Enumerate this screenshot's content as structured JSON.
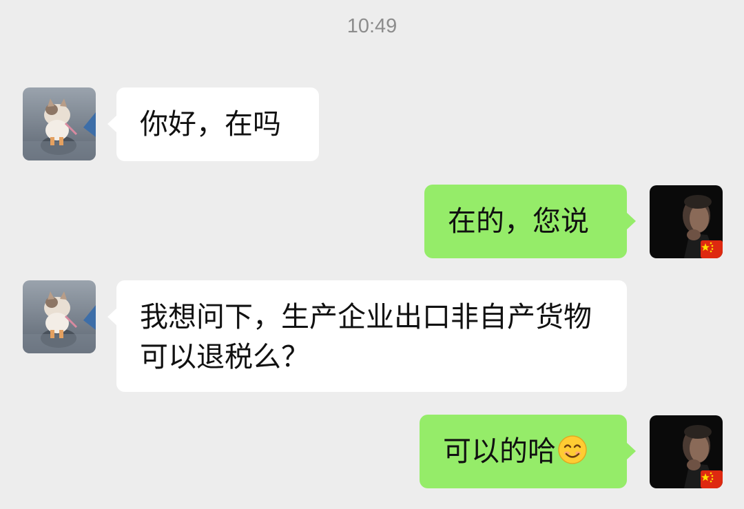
{
  "chat": {
    "timestamp": "10:49",
    "messages": [
      {
        "sender": "contact",
        "text": "你好，在吗"
      },
      {
        "sender": "me",
        "text": "在的，您说"
      },
      {
        "sender": "contact",
        "text": "我想问下，生产企业出口非自产货物可以退税么？"
      },
      {
        "sender": "me",
        "text": "可以的哈",
        "emoji": "smiling-face-emoji"
      }
    ]
  },
  "colors": {
    "background": "#ededed",
    "incoming_bubble": "#ffffff",
    "outgoing_bubble": "#95ec69",
    "timestamp_text": "#8c8c8c"
  },
  "icons": {
    "contact_avatar": "cat-photo-avatar",
    "my_avatar": "man-portrait-avatar",
    "badge": "china-flag-icon"
  }
}
